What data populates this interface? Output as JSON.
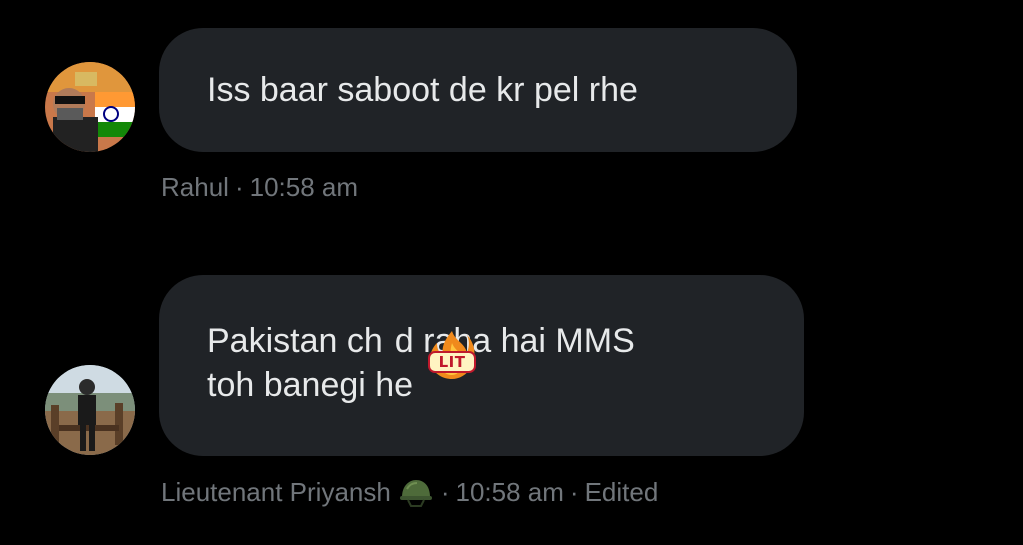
{
  "messages": [
    {
      "text": "Iss baar saboot de kr pel rhe",
      "sender": "Rahul",
      "separator": "·",
      "time": "10:58 am"
    },
    {
      "text_line1_before": "Pakistan ch",
      "text_line1_after": "d raha hai MMS",
      "text_line2": "toh banegi he",
      "sticker_label": "LIT",
      "sender": "Lieutenant Priyansh",
      "separator": "·",
      "time": "10:58 am",
      "edited_label": "Edited"
    }
  ],
  "icons": {
    "avatar_1": "avatar-man-with-indian-flag",
    "avatar_2": "avatar-person-outdoors",
    "sticker": "fire-lit-sticker-icon",
    "sender_badge": "military-helmet-icon"
  },
  "colors": {
    "background": "#000000",
    "bubble": "#202327",
    "message_text": "#e7e9ea",
    "meta_text": "#71767b"
  }
}
